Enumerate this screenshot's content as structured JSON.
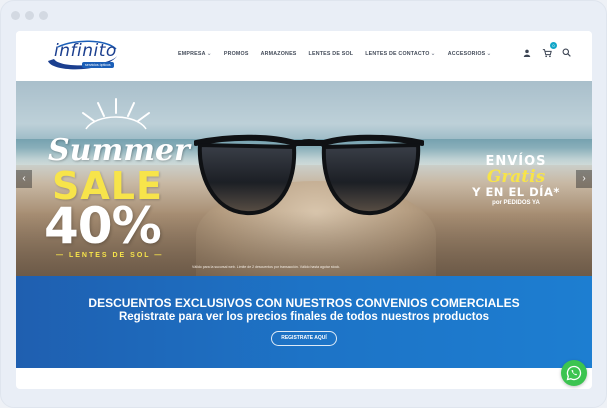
{
  "header": {
    "logo": {
      "name": "infinito",
      "tagline": "servicios ópticos"
    },
    "nav": [
      {
        "label": "EMPRESA",
        "has_dropdown": true
      },
      {
        "label": "PROMOS",
        "has_dropdown": false
      },
      {
        "label": "ARMAZONES",
        "has_dropdown": false
      },
      {
        "label": "LENTES DE SOL",
        "has_dropdown": false
      },
      {
        "label": "LENTES DE CONTACTO",
        "has_dropdown": true
      },
      {
        "label": "ACCESORIOS",
        "has_dropdown": true
      }
    ],
    "cart_count": "0",
    "icons": [
      "user-icon",
      "cart-icon",
      "search-icon"
    ]
  },
  "hero": {
    "summer": "Summer",
    "sale": "SALE",
    "percent": "40%",
    "lentes": "— LENTES DE SOL —",
    "fineprint": "Válido para la sucursal web. Límite de 2 descuentos por transacción. Válido hasta agotar stock.",
    "envios_line1": "ENVÍOS",
    "envios_line2": "Gratis",
    "envios_line3": "Y EN EL DÍA*",
    "envios_line4": "por PEDIDOS YA",
    "arrow_prev": "‹",
    "arrow_next": "›"
  },
  "banner": {
    "line1": "DESCUENTOS EXCLUSIVOS CON NUESTROS CONVENIOS COMERCIALES",
    "line2": "Registrate para ver los precios finales de todos nuestros productos",
    "button": "REGISTRATE AQUÍ"
  },
  "colors": {
    "brand_blue": "#1b3f8f",
    "banner_blue": "#1d73c6",
    "accent_yellow": "#f7e44a",
    "whatsapp_green": "#3cc450",
    "badge_cyan": "#11a6c8"
  }
}
